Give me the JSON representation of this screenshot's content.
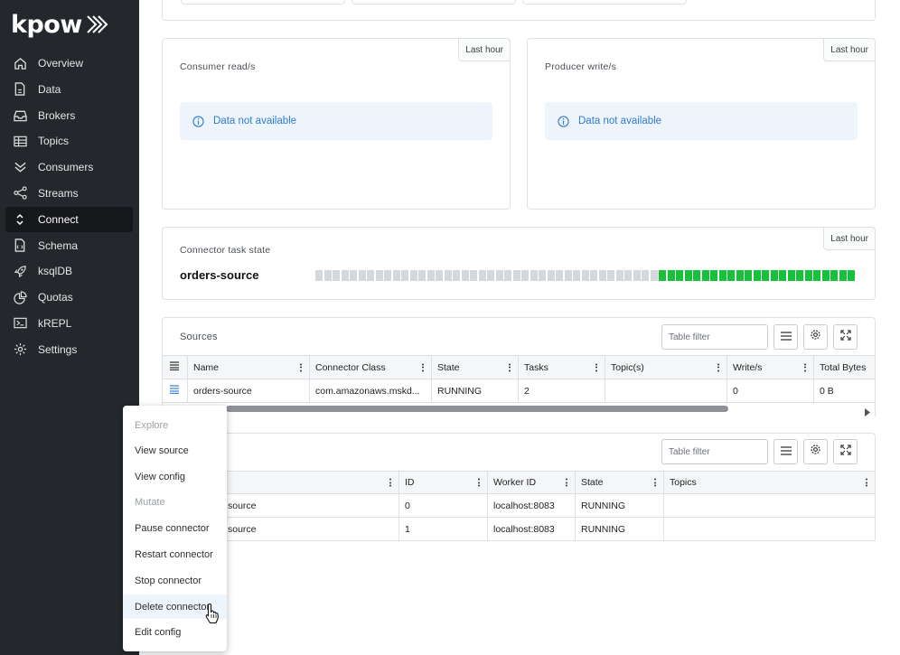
{
  "app": {
    "logo_text": "kpow"
  },
  "sidebar": {
    "items": [
      {
        "label": "Overview",
        "icon": "home-icon"
      },
      {
        "label": "Data",
        "icon": "document-icon"
      },
      {
        "label": "Brokers",
        "icon": "inbox-icon"
      },
      {
        "label": "Topics",
        "icon": "table-icon"
      },
      {
        "label": "Consumers",
        "icon": "chevrons-down-icon"
      },
      {
        "label": "Streams",
        "icon": "share-icon"
      },
      {
        "label": "Connect",
        "icon": "chevrons-updown-icon",
        "active": true
      },
      {
        "label": "Schema",
        "icon": "file-code-icon"
      },
      {
        "label": "ksqlDB",
        "icon": "rocket-icon"
      },
      {
        "label": "Quotas",
        "icon": "pie-icon"
      },
      {
        "label": "kREPL",
        "icon": "terminal-icon"
      },
      {
        "label": "Settings",
        "icon": "gear-icon"
      }
    ]
  },
  "consumer_card": {
    "title": "Consumer read/s",
    "range": "Last hour",
    "message": "Data not available"
  },
  "producer_card": {
    "title": "Producer write/s",
    "range": "Last hour",
    "message": "Data not available"
  },
  "task_state_card": {
    "title": "Connector task state",
    "range": "Last hour",
    "connector": "orders-source",
    "segments_grey": 40,
    "segments_green": 23
  },
  "sources": {
    "title": "Sources",
    "filter_placeholder": "Table filter",
    "columns": [
      "Name",
      "Connector Class",
      "State",
      "Tasks",
      "Topic(s)",
      "Write/s",
      "Total Bytes"
    ],
    "rows": [
      {
        "name": "orders-source",
        "class": "com.amazonaws.mskd...",
        "state": "RUNNING",
        "tasks": "2",
        "topics": "",
        "writes": "0",
        "bytes": "0 B"
      }
    ]
  },
  "tasks": {
    "filter_placeholder": "Table filter",
    "columns": [
      "",
      "ID",
      "Worker ID",
      "State",
      "Topics"
    ],
    "rows": [
      {
        "name": "source",
        "id": "0",
        "worker": "localhost:8083",
        "state": "RUNNING",
        "topics": ""
      },
      {
        "name": "source",
        "id": "1",
        "worker": "localhost:8083",
        "state": "RUNNING",
        "topics": ""
      }
    ]
  },
  "context_menu": {
    "explore_header": "Explore",
    "view_source": "View source",
    "view_config": "View config",
    "mutate_header": "Mutate",
    "pause": "Pause connector",
    "restart": "Restart connector",
    "stop": "Stop connector",
    "delete": "Delete connector",
    "edit": "Edit config"
  },
  "colors": {
    "sidebar_bg": "#24272b",
    "info_text": "#2f7dd1",
    "task_grey": "#d3d8dd",
    "task_green": "#16c23a"
  }
}
